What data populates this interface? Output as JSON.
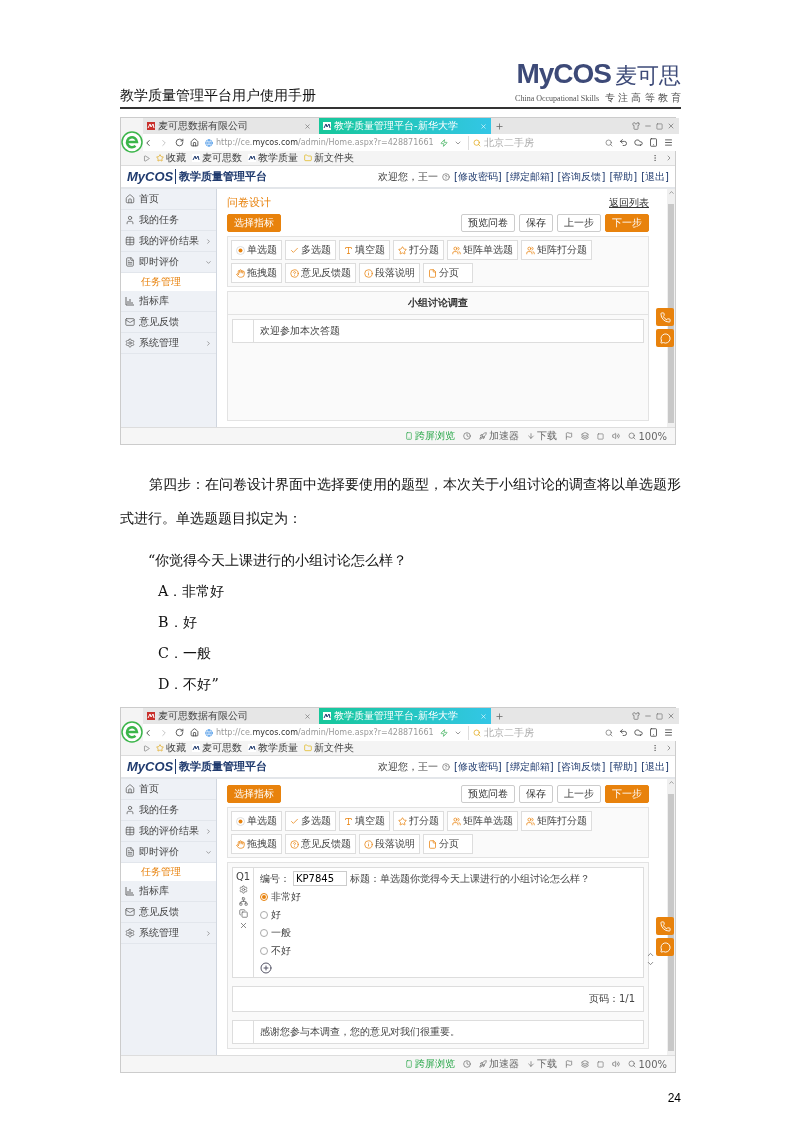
{
  "document": {
    "header_title": "教学质量管理平台用户使用手册",
    "logo": {
      "brand": "MyCOS",
      "name": "麦可思",
      "tagline_en": "China Occupational Skills",
      "tagline_cn": "专 注 高 等 教 育"
    },
    "page_number": "24"
  },
  "screenshots": [
    {
      "browser": {
        "tabs": [
          {
            "label": "麦可思数据有限公司",
            "selected": false
          },
          {
            "label": "教学质量管理平台-新华大学",
            "selected": true
          }
        ],
        "url": "http://ce.**mycos.com**/admin/Home.aspx?r=428871661",
        "search": {
          "placeholder": "北京二手房"
        },
        "bookmarks": [
          "收藏",
          "麦可思数",
          "教学质量",
          "新文件夹"
        ]
      },
      "app": {
        "brand": "MyCOS",
        "title": "教学质量管理平台",
        "welcome": "欢迎您，王一",
        "user_links": [
          "[修改密码]",
          "[绑定邮箱]",
          "[咨询反馈]",
          "[帮助]",
          "[退出]"
        ],
        "sidebar": [
          {
            "label": "首页",
            "kind": "link"
          },
          {
            "label": "我的任务",
            "kind": "link"
          },
          {
            "label": "我的评价结果",
            "kind": "menu",
            "expanded": false
          },
          {
            "label": "即时评价",
            "kind": "menu",
            "expanded": true,
            "children": [
              {
                "label": "任务管理",
                "selected": true
              }
            ]
          },
          {
            "label": "指标库",
            "kind": "link"
          },
          {
            "label": "意见反馈",
            "kind": "link"
          },
          {
            "label": "系统管理",
            "kind": "menu",
            "expanded": false
          }
        ],
        "page_title": "问卷设计",
        "back_link": "返回列表",
        "index_button": "选择指标",
        "actions": [
          {
            "label": "预览问卷",
            "primary": false
          },
          {
            "label": "保存",
            "primary": false
          },
          {
            "label": "上一步",
            "primary": false
          },
          {
            "label": "下一步",
            "primary": true
          }
        ],
        "question_types": [
          "单选题",
          "多选题",
          "填空题",
          "打分题",
          "矩阵单选题",
          "矩阵打分题",
          "拖拽题",
          "意见反馈题",
          "段落说明",
          "分页"
        ],
        "survey": {
          "title": "小组讨论调查",
          "intro": "欢迎参加本次答题"
        }
      },
      "status_bar": {
        "cross_screen": "跨屏浏览",
        "accelerator": "加速器",
        "download": "下载",
        "zoom": "100%"
      }
    },
    {
      "browser": {
        "tabs": [
          {
            "label": "麦可思数据有限公司",
            "selected": false
          },
          {
            "label": "教学质量管理平台-新华大学",
            "selected": true
          }
        ],
        "url": "http://ce.**mycos.com**/admin/Home.aspx?r=428871661",
        "search": {
          "placeholder": "北京二手房"
        },
        "bookmarks": [
          "收藏",
          "麦可思数",
          "教学质量",
          "新文件夹"
        ]
      },
      "app": {
        "brand": "MyCOS",
        "title": "教学质量管理平台",
        "welcome": "欢迎您，王一",
        "user_links": [
          "[修改密码]",
          "[绑定邮箱]",
          "[咨询反馈]",
          "[帮助]",
          "[退出]"
        ],
        "sidebar": [
          {
            "label": "首页",
            "kind": "link"
          },
          {
            "label": "我的任务",
            "kind": "link"
          },
          {
            "label": "我的评价结果",
            "kind": "menu",
            "expanded": false
          },
          {
            "label": "即时评价",
            "kind": "menu",
            "expanded": true,
            "children": [
              {
                "label": "任务管理",
                "selected": true
              }
            ]
          },
          {
            "label": "指标库",
            "kind": "link"
          },
          {
            "label": "意见反馈",
            "kind": "link"
          },
          {
            "label": "系统管理",
            "kind": "menu",
            "expanded": false
          }
        ],
        "index_button": "选择指标",
        "actions": [
          {
            "label": "预览问卷",
            "primary": false
          },
          {
            "label": "保存",
            "primary": false
          },
          {
            "label": "上一步",
            "primary": false
          },
          {
            "label": "下一步",
            "primary": true
          }
        ],
        "question_types": [
          "单选题",
          "多选题",
          "填空题",
          "打分题",
          "矩阵单选题",
          "矩阵打分题",
          "拖拽题",
          "意见反馈题",
          "段落说明",
          "分页"
        ],
        "question": {
          "number": "Q1",
          "code_label": "编号：",
          "code_value": "KP7845",
          "title": "标题：单选题你觉得今天上课进行的小组讨论怎么样？",
          "options": [
            {
              "label": "非常好",
              "selected": true
            },
            {
              "label": "好",
              "selected": false
            },
            {
              "label": "一般",
              "selected": false
            },
            {
              "label": "不好",
              "selected": false
            }
          ]
        },
        "page_indicator": "页码：1/1",
        "closing": "感谢您参与本调查，您的意见对我们很重要。"
      },
      "status_bar": {
        "cross_screen": "跨屏浏览",
        "accelerator": "加速器",
        "download": "下载",
        "zoom": "100%"
      }
    }
  ],
  "body": {
    "paragraph": "第四步：在问卷设计界面中选择要使用的题型，本次关于小组讨论的调查将以单选题形式进行。单选题题目拟定为：",
    "quote": "“你觉得今天上课进行的小组讨论怎么样？",
    "options": [
      "A．非常好",
      "B．好",
      "C．一般",
      "D．不好”"
    ]
  }
}
